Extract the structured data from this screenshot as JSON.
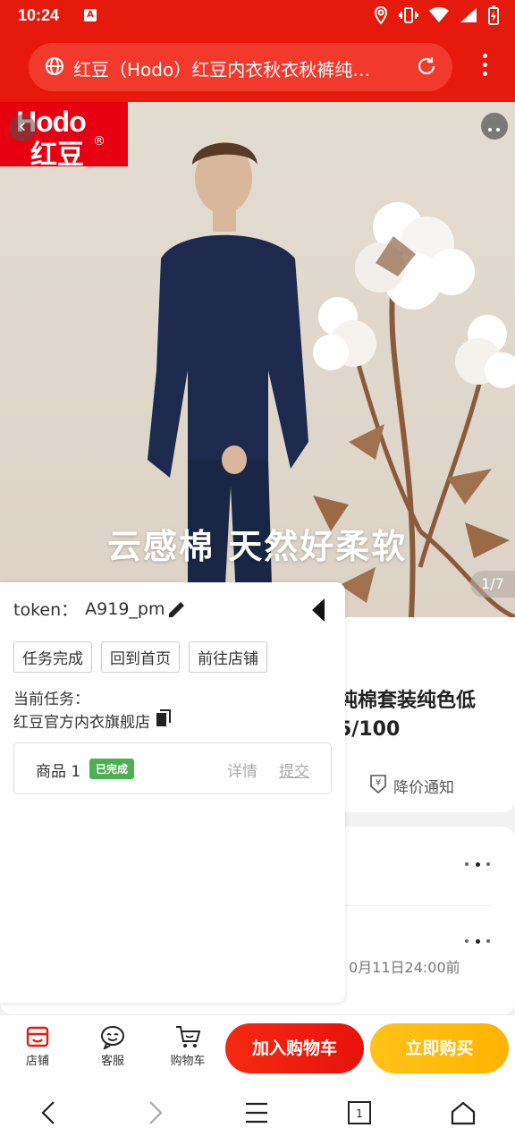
{
  "status_bar": {
    "time": "10:24"
  },
  "browser": {
    "title": "红豆（Hodo）红豆内衣秋衣秋裤纯…"
  },
  "product": {
    "logo_en": "Hodo",
    "logo_cn": "红豆",
    "logo_reg": "®",
    "hero_caption": "云感棉 天然好柔软",
    "image_counter": "1/7",
    "name_partial": [
      "纯棉套装纯色低",
      "5/100"
    ],
    "price_notify": "降价通知",
    "deadline_partial": "0月11日24:00前"
  },
  "overlay": {
    "token_label": "token：",
    "token_value": "A919_pm",
    "buttons": [
      "任务完成",
      "回到首页",
      "前往店铺"
    ],
    "current_task_label": "当前任务：",
    "current_shop": "红豆官方内衣旗舰店",
    "item_label": "商品 1",
    "item_status": "已完成",
    "item_detail": "详情",
    "item_submit": "提交"
  },
  "bottom_bar": {
    "shop": "店铺",
    "service": "客服",
    "cart": "购物车",
    "add_to_cart": "加入购物车",
    "buy_now": "立即购买"
  },
  "nav_bar": {
    "tab_count": "1"
  },
  "colors": {
    "brand_red": "#e61a0c",
    "buy_yellow": "#ffb400",
    "done_green": "#4caf50"
  }
}
